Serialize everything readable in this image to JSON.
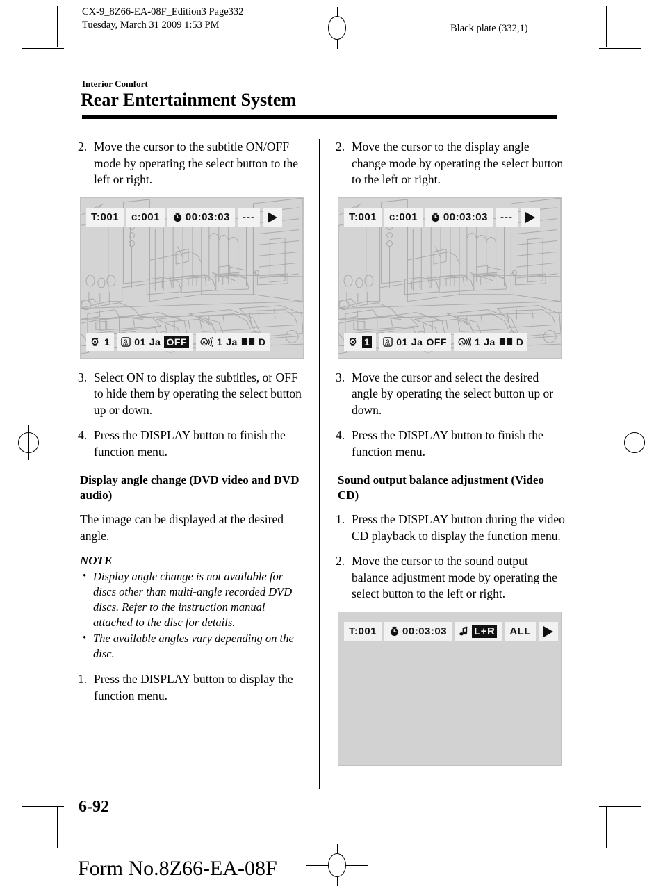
{
  "page_header": {
    "slug_line1": "CX-9_8Z66-EA-08F_Edition3 Page332",
    "slug_line2": "Tuesday, March 31 2009 1:53 PM",
    "black_plate": "Black plate (332,1)"
  },
  "chapter": {
    "section": "Interior Comfort",
    "title": "Rear Entertainment System"
  },
  "left_column": {
    "step2": {
      "num": "2.",
      "text": "Move the cursor to the subtitle ON/OFF mode by operating the select button to the left or right."
    },
    "step3": {
      "num": "3.",
      "text": "Select ON to display the subtitles, or OFF to hide them by operating the select button up or down."
    },
    "step4": {
      "num": "4.",
      "text": "Press the DISPLAY button to finish the function menu."
    },
    "subheading": "Display angle change (DVD video and DVD audio)",
    "paragraph": "The image can be displayed at the desired angle.",
    "note_heading": "NOTE",
    "notes": [
      "Display angle change is not available for discs other than multi-angle recorded DVD discs. Refer to the instruction manual attached to the disc for details.",
      "The available angles vary depending on the disc."
    ],
    "step1b": {
      "num": "1.",
      "text": "Press the DISPLAY button to display the function menu."
    },
    "screen": {
      "track": "T:001",
      "chapter": "c:001",
      "time": "00:03:03",
      "repeat": "---",
      "play": "play-triangle",
      "angle_value": "1",
      "subtitle_num": "01",
      "subtitle_lang": "Ja",
      "subtitle_state": "OFF",
      "subtitle_state_highlighted": true,
      "audio_num": "1",
      "audio_lang": "Ja",
      "audio_format": "D",
      "angle_highlighted": false
    }
  },
  "right_column": {
    "step2": {
      "num": "2.",
      "text": "Move the cursor to the display angle change mode by operating the select button to the left or right."
    },
    "step3": {
      "num": "3.",
      "text": "Move the cursor and select the desired angle by operating the select button up or down."
    },
    "step4": {
      "num": "4.",
      "text": "Press the DISPLAY button to finish the function menu."
    },
    "subheading": "Sound output balance adjustment (Video CD)",
    "step1": {
      "num": "1.",
      "text": "Press the DISPLAY button during the video CD playback to display the function menu."
    },
    "step2b": {
      "num": "2.",
      "text": "Move the cursor to the sound output balance adjustment mode by operating the select button to the left or right."
    },
    "screen": {
      "track": "T:001",
      "chapter": "c:001",
      "time": "00:03:03",
      "repeat": "---",
      "play": "play-triangle",
      "angle_value": "1",
      "subtitle_num": "01",
      "subtitle_lang": "Ja",
      "subtitle_state": "OFF",
      "subtitle_state_highlighted": false,
      "audio_num": "1",
      "audio_lang": "Ja",
      "audio_format": "D",
      "angle_highlighted": true
    },
    "screen_vcd": {
      "track": "T:001",
      "time": "00:03:03",
      "balance": "L+R",
      "balance_highlighted": true,
      "repeat_mode": "ALL",
      "play": "play-triangle"
    }
  },
  "footer": {
    "folio": "6-92",
    "form_no": "Form No.8Z66-EA-08F"
  }
}
